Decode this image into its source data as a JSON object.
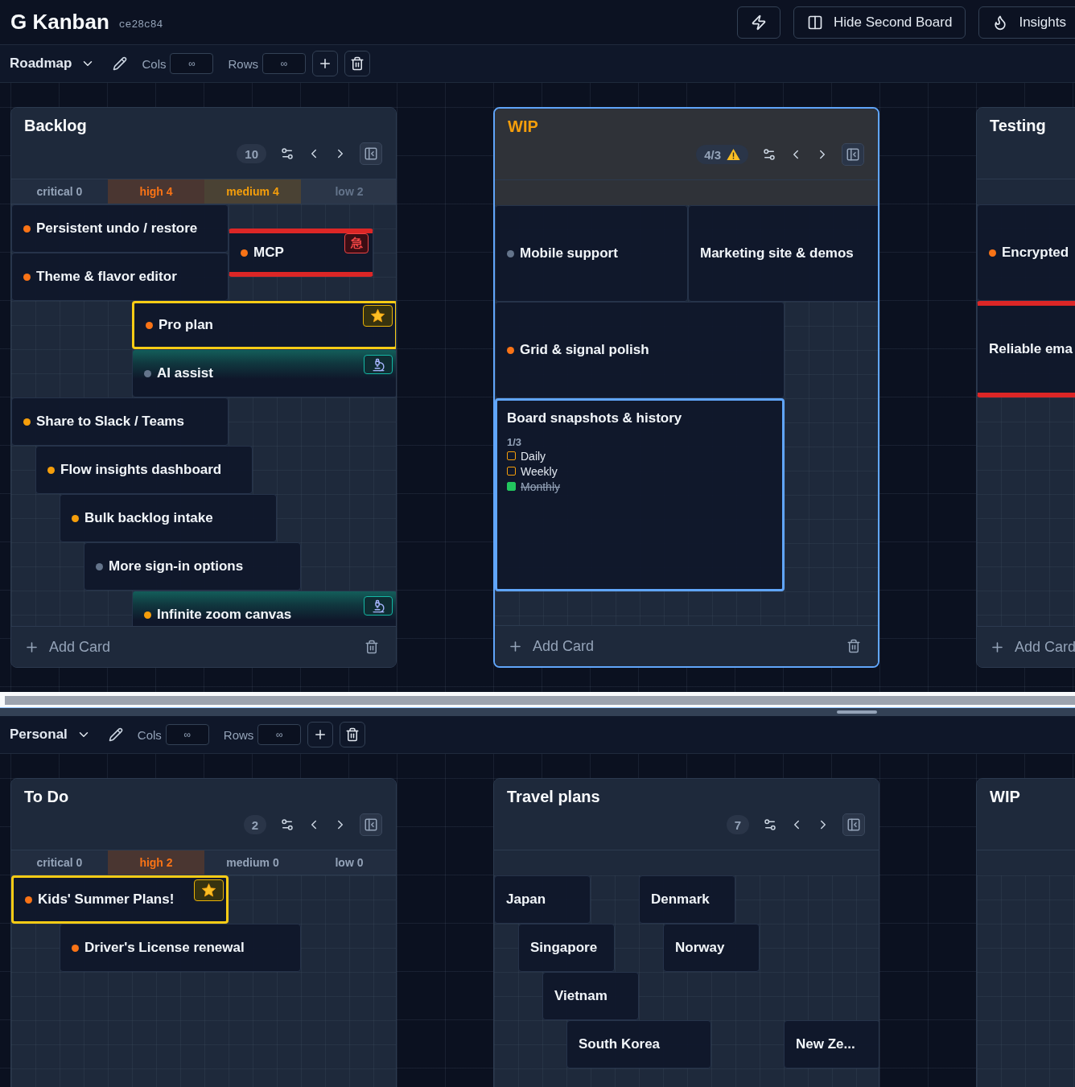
{
  "app": {
    "title": "G Kanban",
    "version": "ce28c84"
  },
  "actions": [
    {
      "kind": "quick"
    },
    {
      "kind": "layout",
      "label": "Hide Second Board"
    },
    {
      "kind": "insights",
      "label": "Insights"
    }
  ],
  "boards": [
    {
      "name": "Roadmap",
      "fields": [
        {
          "label": "Cols",
          "placeholder": "∞"
        },
        {
          "label": "Rows",
          "placeholder": "∞"
        }
      ],
      "columns": [
        {
          "title": "Backlog",
          "selected": false,
          "over_limit": false,
          "count": "10",
          "priorities": [
            {
              "kind": "critical",
              "label": "critical 0",
              "highlighted": false
            },
            {
              "kind": "high",
              "label": "high 4",
              "highlighted": true
            },
            {
              "kind": "medium",
              "label": "medium 4",
              "highlighted": true
            },
            {
              "kind": "low",
              "label": "low 2",
              "highlighted": true
            }
          ],
          "cards": [
            {
              "title": "Persistent undo / restore",
              "color": "#f97316",
              "kind": "plain",
              "selected": false
            },
            {
              "title": "Theme & flavor editor",
              "color": "#f97316",
              "kind": "plain",
              "selected": false
            },
            {
              "title": "MCP",
              "color": "#f97316",
              "kind": "urgent",
              "badge": "急",
              "selected": false
            },
            {
              "title": "Pro plan",
              "color": "#f97316",
              "kind": "starred",
              "selected": false
            },
            {
              "title": "AI assist",
              "color": "#64748b",
              "kind": "research",
              "selected": false
            },
            {
              "title": "Share to Slack / Teams",
              "color": "#f59e0b",
              "kind": "plain",
              "selected": false
            },
            {
              "title": "Flow insights dashboard",
              "color": "#f59e0b",
              "kind": "plain",
              "selected": false
            },
            {
              "title": "Bulk backlog intake",
              "color": "#f59e0b",
              "kind": "plain",
              "selected": false
            },
            {
              "title": "More sign-in options",
              "color": "#64748b",
              "kind": "plain",
              "selected": false
            },
            {
              "title": "Infinite zoom canvas",
              "color": "#f59e0b",
              "kind": "research",
              "selected": false
            }
          ],
          "add_label": "Add Card"
        },
        {
          "title": "WIP",
          "selected": true,
          "over_limit": true,
          "count": "4/3",
          "cards": [
            {
              "title": "Mobile support",
              "color": "#64748b",
              "kind": "plain",
              "selected": false
            },
            {
              "title": "Marketing site & demos",
              "kind": "plain",
              "selected": false
            },
            {
              "title": "Grid & signal polish",
              "color": "#f97316",
              "kind": "plain",
              "selected": false
            },
            {
              "title": "Board snapshots & history",
              "kind": "plain",
              "selected": true,
              "checklist": {
                "progress": "1/3",
                "items": [
                  {
                    "label": "Daily",
                    "checked": false
                  },
                  {
                    "label": "Weekly",
                    "checked": false
                  },
                  {
                    "label": "Monthly",
                    "checked": true
                  }
                ]
              }
            }
          ],
          "add_label": "Add Card"
        },
        {
          "title": "Testing",
          "selected": false,
          "over_limit": false,
          "cards": [
            {
              "title": "Encrypted",
              "color": "#f97316",
              "kind": "plain",
              "selected": false
            },
            {
              "title": "Reliable ema",
              "kind": "urgent",
              "selected": false
            }
          ],
          "add_label": "Add Card"
        }
      ]
    },
    {
      "name": "Personal",
      "fields": [
        {
          "label": "Cols",
          "placeholder": "∞"
        },
        {
          "label": "Rows",
          "placeholder": "∞"
        }
      ],
      "columns": [
        {
          "title": "To Do",
          "selected": false,
          "over_limit": false,
          "count": "2",
          "priorities": [
            {
              "kind": "critical",
              "label": "critical 0",
              "highlighted": false
            },
            {
              "kind": "high",
              "label": "high 2",
              "highlighted": true
            },
            {
              "kind": "medium",
              "label": "medium 0",
              "highlighted": false
            },
            {
              "kind": "low",
              "label": "low 0",
              "highlighted": false
            }
          ],
          "cards": [
            {
              "title": "Kids' Summer Plans!",
              "color": "#f97316",
              "kind": "starred",
              "selected": false
            },
            {
              "title": "Driver's License renewal",
              "color": "#f97316",
              "kind": "plain",
              "selected": false
            }
          ]
        },
        {
          "title": "Travel plans",
          "selected": false,
          "over_limit": false,
          "count": "7",
          "cards": [
            {
              "title": "Japan",
              "kind": "plain",
              "selected": false
            },
            {
              "title": "Denmark",
              "kind": "plain",
              "selected": false
            },
            {
              "title": "Singapore",
              "kind": "plain",
              "selected": false
            },
            {
              "title": "Norway",
              "kind": "plain",
              "selected": false
            },
            {
              "title": "Vietnam",
              "kind": "plain",
              "selected": false
            },
            {
              "title": "South Korea",
              "kind": "plain",
              "selected": false
            },
            {
              "title": "New Ze...",
              "kind": "plain",
              "selected": false
            }
          ]
        },
        {
          "title": "WIP",
          "selected": false,
          "over_limit": false
        }
      ]
    }
  ]
}
